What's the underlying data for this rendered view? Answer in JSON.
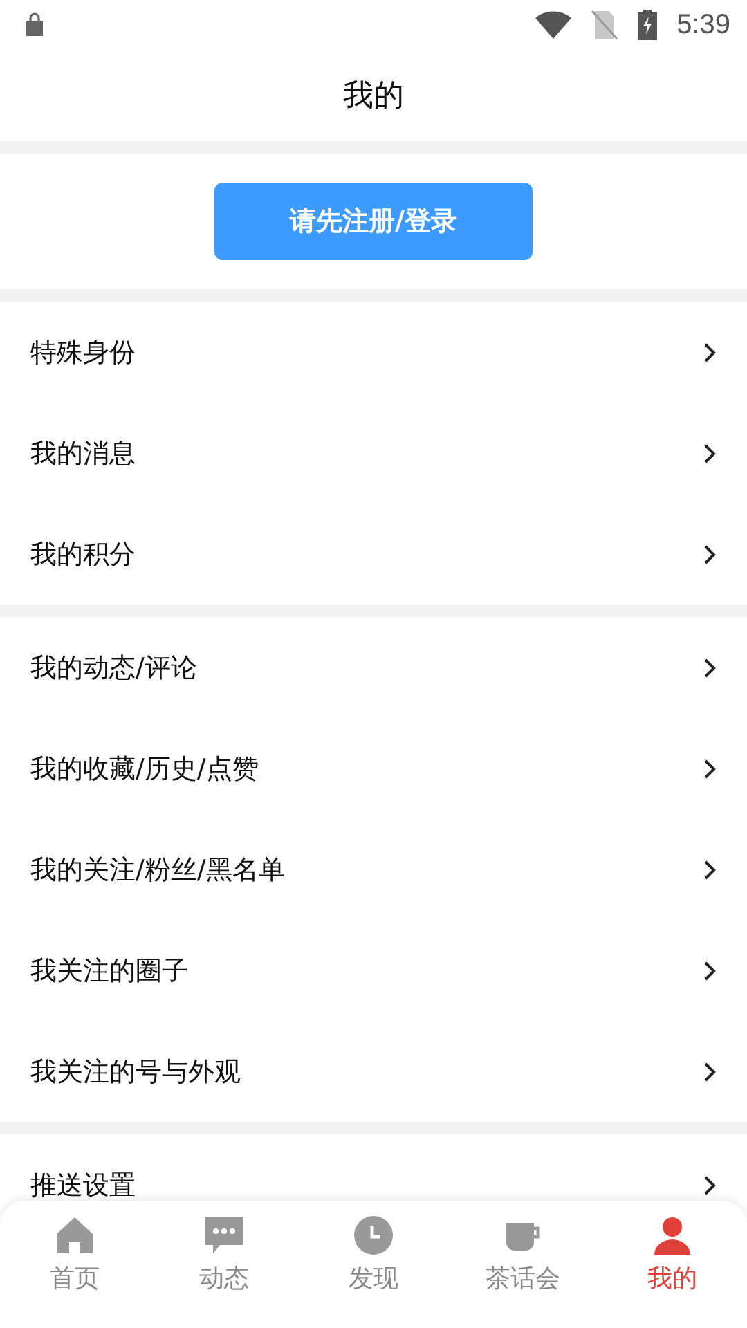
{
  "status_bar": {
    "time": "5:39"
  },
  "header": {
    "title": "我的"
  },
  "login_button": "请先注册/登录",
  "sections": [
    {
      "rows": [
        {
          "label": "特殊身份"
        },
        {
          "label": "我的消息"
        },
        {
          "label": "我的积分"
        }
      ]
    },
    {
      "rows": [
        {
          "label": "我的动态/评论"
        },
        {
          "label": "我的收藏/历史/点赞"
        },
        {
          "label": "我的关注/粉丝/黑名单"
        },
        {
          "label": "我关注的圈子"
        },
        {
          "label": "我关注的号与外观"
        }
      ]
    },
    {
      "rows": [
        {
          "label": "推送设置"
        }
      ]
    }
  ],
  "tabs": [
    {
      "label": "首页",
      "kind": "home",
      "selected": false
    },
    {
      "label": "动态",
      "kind": "chat",
      "selected": false
    },
    {
      "label": "发现",
      "kind": "clock",
      "selected": false
    },
    {
      "label": "茶话会",
      "kind": "cup",
      "selected": false
    },
    {
      "label": "我的",
      "kind": "person",
      "selected": true
    }
  ]
}
